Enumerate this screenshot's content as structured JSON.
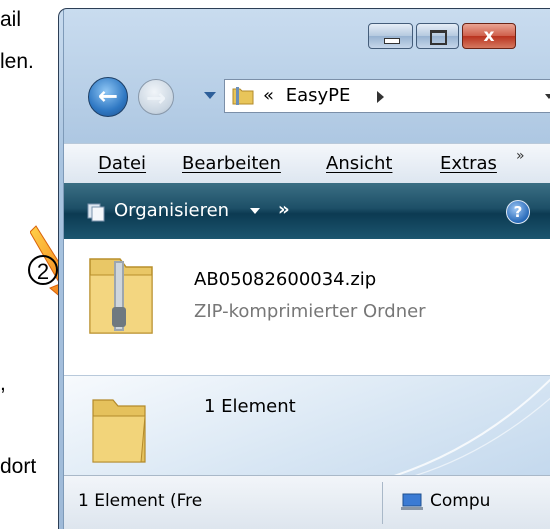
{
  "document_fragments": {
    "line1": "ail",
    "line2": "len.",
    "line3": ",",
    "line4": "dort"
  },
  "window": {
    "caption_buttons": {
      "minimize_icon": "minimize-icon",
      "maximize_icon": "maximize-icon",
      "close_label": "x"
    },
    "nav": {
      "back_icon": "back-arrow-icon",
      "forward_icon": "forward-arrow-icon"
    },
    "address": {
      "prefix": "«",
      "path": "EasyPE"
    },
    "menu": {
      "items": [
        "Datei",
        "Bearbeiten",
        "Ansicht",
        "Extras"
      ],
      "more": "»"
    },
    "toolbar": {
      "organize_label": "Organisieren",
      "more": "»",
      "help_label": "?"
    },
    "file": {
      "name": "AB05082600034.zip",
      "type": "ZIP-komprimierter Ordner",
      "icon": "zip-folder-icon"
    },
    "details": {
      "text": "1 Element",
      "icon": "folder-icon"
    },
    "status": {
      "left": "1 Element (Fre",
      "right": "Compu",
      "icon": "computer-icon"
    }
  },
  "annotation": {
    "number": "2",
    "arrow_color": "#f07a10"
  },
  "colors": {
    "toolbar": "#1d4f67",
    "frame": "#a9c4e0",
    "close_button": "#cf5f4b"
  }
}
